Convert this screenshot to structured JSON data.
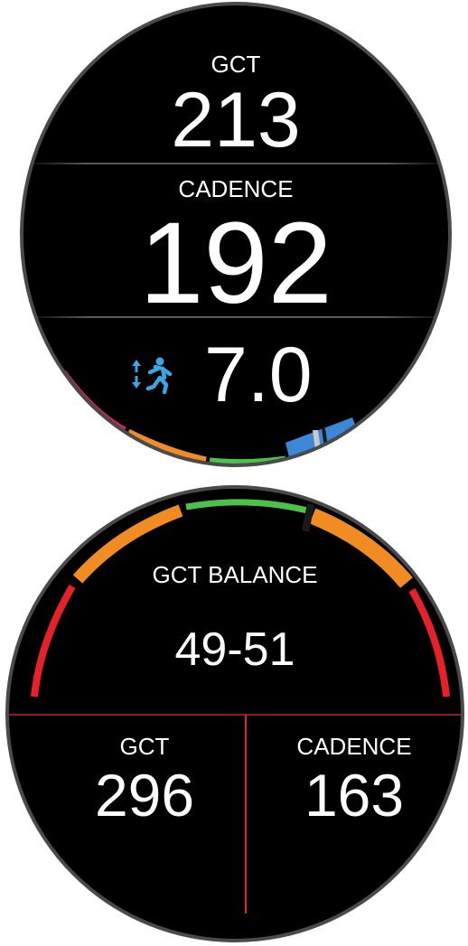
{
  "watch_top": {
    "top_field": {
      "label": "GCT",
      "value": "213"
    },
    "middle_field": {
      "label": "CADENCE",
      "value": "192"
    },
    "bottom_field": {
      "icon": "vertical-ratio-runner-icon",
      "value": "7.0"
    },
    "zone_gauge": {
      "colors": [
        "#e0245e",
        "#f08c2a",
        "#4cc24a",
        "#3d87d8",
        "#7a4fc4"
      ],
      "marker_color": "#c8c8c8"
    }
  },
  "watch_bottom": {
    "balance": {
      "label": "GCT BALANCE",
      "value": "49-51"
    },
    "left_field": {
      "label": "GCT",
      "value": "296"
    },
    "right_field": {
      "label": "CADENCE",
      "value": "163"
    },
    "balance_gauge": {
      "colors": [
        "#e8202a",
        "#f08c22",
        "#4cc24a"
      ],
      "marker_color": "#1a1a1a",
      "divider_color": "#d8262e"
    }
  }
}
